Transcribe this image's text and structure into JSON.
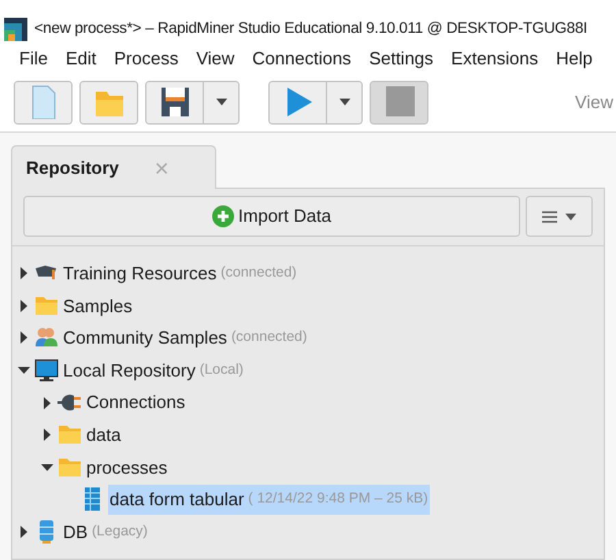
{
  "window": {
    "title": "<new process*> – RapidMiner Studio Educational 9.10.011 @ DESKTOP-TGUG88I"
  },
  "menu": [
    "File",
    "Edit",
    "Process",
    "View",
    "Connections",
    "Settings",
    "Extensions",
    "Help"
  ],
  "toolbar": {
    "buttons": [
      {
        "kind": "new",
        "disabled": false
      },
      {
        "kind": "open",
        "disabled": false
      },
      {
        "kind": "save",
        "disabled": false
      },
      {
        "kind": "run",
        "disabled": false
      },
      {
        "kind": "stop",
        "disabled": true
      }
    ],
    "views_label": "View"
  },
  "repository": {
    "tab": {
      "label": "Repository",
      "selected": true,
      "close": "×"
    },
    "import_button": "Import Data",
    "tree": [
      {
        "label": "Training Resources",
        "note": "(connected)",
        "kind": "cloud",
        "expanded": false,
        "selected": false
      },
      {
        "label": "Samples",
        "kind": "folder",
        "expanded": false,
        "selected": false
      },
      {
        "label": "Community Samples",
        "note": "(connected)",
        "kind": "people",
        "expanded": false,
        "selected": false
      },
      {
        "label": "Local Repository",
        "note": "(Local)",
        "kind": "monitor",
        "expanded": true,
        "selected": false,
        "children": [
          {
            "label": "Connections",
            "kind": "plug",
            "expanded": false,
            "selected": false
          },
          {
            "label": "data",
            "kind": "folder",
            "expanded": false,
            "selected": false
          },
          {
            "label": "processes",
            "kind": "folder",
            "expanded": true,
            "selected": false,
            "children": [
              {
                "label": "data form tabular",
                "note": "( 12/14/22 9:48 PM – 25 kB)",
                "kind": "process",
                "selected": true
              }
            ]
          }
        ]
      },
      {
        "label": "DB",
        "note": "(Legacy)",
        "kind": "db",
        "expanded": false,
        "selected": false
      }
    ]
  }
}
